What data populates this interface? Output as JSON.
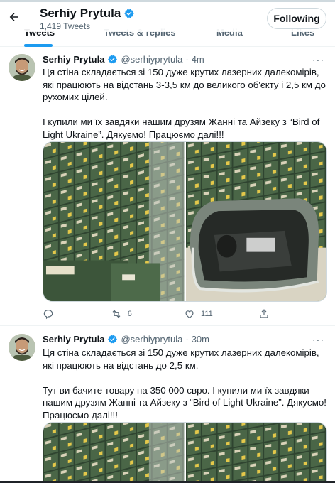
{
  "header": {
    "name": "Serhiy Prytula",
    "tweet_count": "1,419 Tweets",
    "follow_label": "Following"
  },
  "tabs": [
    {
      "label": "Tweets"
    },
    {
      "label": "Tweets & replies"
    },
    {
      "label": "Media"
    },
    {
      "label": "Likes"
    }
  ],
  "tweets": [
    {
      "name": "Serhiy Prytula",
      "handle": "@serhiyprytula",
      "dot": "·",
      "time": "4m",
      "text": "Ця стіна складається зі 150 дуже крутих лазерних далекомірів, які працюють на відстань 3-3,5 км до великого об'єкту і 2,5 км до рухомих цілей.\n\nІ купили ми їх завдяки нашим друзям Жанні та Айзеку з “Bird of Light Ukraine”. Дякуємо! Працюємо далі!!!",
      "replies": "",
      "retweets": "6",
      "likes": "111"
    },
    {
      "name": "Serhiy Prytula",
      "handle": "@serhiyprytula",
      "dot": "·",
      "time": "30m",
      "text": "Ця стіна складається зі 150 дуже крутих лазерних далекомірів, які працюють на відстань до 2,5 км.\n\nТут ви бачите товару на 350 000 євро. І купили ми їх завдяки нашим друзям Жанні та Айзеку з “Bird of Light Ukraine”. Дякуємо! Працюємо далі!!!"
    }
  ],
  "colors": {
    "accent": "#1d9bf0",
    "text": "#0f1419",
    "secondary": "#536471",
    "box_green": "#3f5a3c"
  },
  "icons": [
    "back-arrow-icon",
    "verified-badge-icon",
    "more-icon",
    "reply-icon",
    "retweet-icon",
    "like-icon",
    "share-icon"
  ]
}
